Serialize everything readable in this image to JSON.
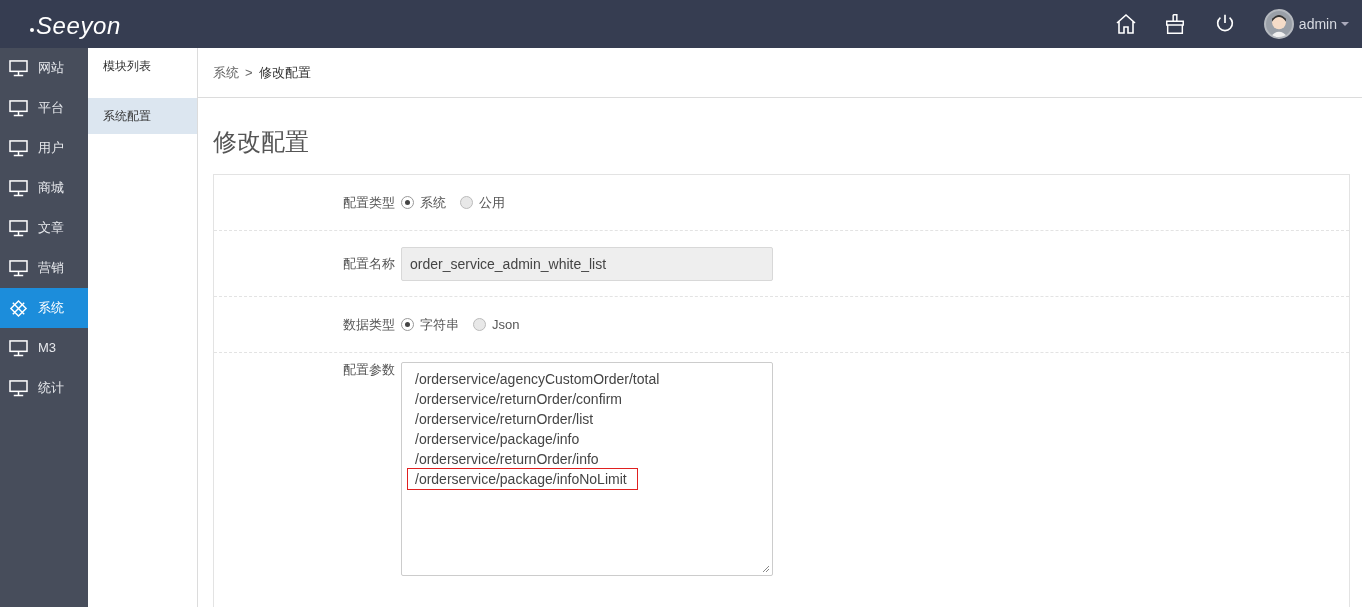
{
  "header": {
    "logo": "Seeyon",
    "user": "admin"
  },
  "sidebar": {
    "items": [
      {
        "label": "网站",
        "selected": false,
        "kind": "monitor"
      },
      {
        "label": "平台",
        "selected": false,
        "kind": "monitor"
      },
      {
        "label": "用户",
        "selected": false,
        "kind": "monitor"
      },
      {
        "label": "商城",
        "selected": false,
        "kind": "monitor"
      },
      {
        "label": "文章",
        "selected": false,
        "kind": "monitor"
      },
      {
        "label": "营销",
        "selected": false,
        "kind": "monitor"
      },
      {
        "label": "系统",
        "selected": true,
        "kind": "network"
      },
      {
        "label": "M3",
        "selected": false,
        "kind": "monitor"
      },
      {
        "label": "统计",
        "selected": false,
        "kind": "monitor"
      }
    ]
  },
  "submenu": {
    "items": [
      {
        "label": "模块列表",
        "selected": false
      },
      {
        "label": "系统配置",
        "selected": true
      }
    ]
  },
  "breadcrumb": {
    "parent": "系统",
    "separator": ">",
    "current": "修改配置"
  },
  "page_title": "修改配置",
  "form": {
    "config_type": {
      "label": "配置类型",
      "options": [
        {
          "label": "系统",
          "selected": true
        },
        {
          "label": "公用",
          "selected": false
        }
      ]
    },
    "config_name": {
      "label": "配置名称",
      "value": "order_service_admin_white_list"
    },
    "data_type": {
      "label": "数据类型",
      "options": [
        {
          "label": "字符串",
          "selected": true
        },
        {
          "label": "Json",
          "selected": false
        }
      ]
    },
    "config_params": {
      "label": "配置参数",
      "lines": [
        {
          "text": "/orderservice/agencyCustomOrder/total",
          "highlighted": false
        },
        {
          "text": "/orderservice/returnOrder/confirm",
          "highlighted": false
        },
        {
          "text": "/orderservice/returnOrder/list",
          "highlighted": false
        },
        {
          "text": "/orderservice/package/info",
          "highlighted": false
        },
        {
          "text": "/orderservice/returnOrder/info",
          "highlighted": false
        },
        {
          "text": "/orderservice/package/infoNoLimit",
          "highlighted": true
        }
      ]
    }
  }
}
